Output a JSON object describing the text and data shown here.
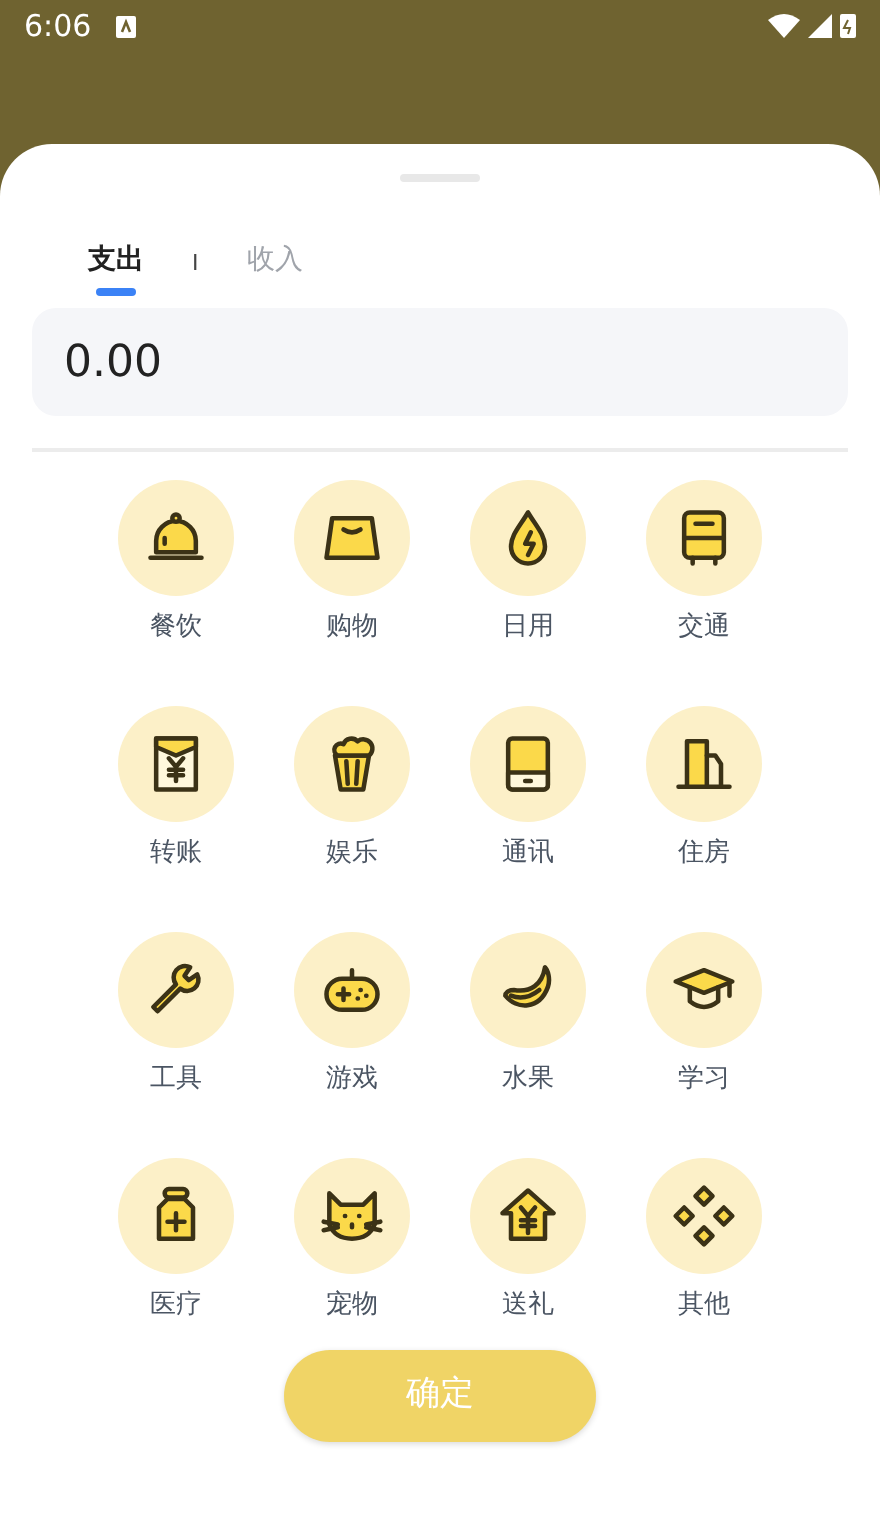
{
  "status_bar": {
    "time": "6:06"
  },
  "tabs": [
    {
      "label": "支出",
      "selected": true
    },
    {
      "label": "收入",
      "selected": false
    }
  ],
  "tab_separator": "I",
  "amount": {
    "value": "0.00"
  },
  "categories": [
    {
      "label": "餐饮"
    },
    {
      "label": "购物"
    },
    {
      "label": "日用"
    },
    {
      "label": "交通"
    },
    {
      "label": "转账"
    },
    {
      "label": "娱乐"
    },
    {
      "label": "通讯"
    },
    {
      "label": "住房"
    },
    {
      "label": "工具"
    },
    {
      "label": "游戏"
    },
    {
      "label": "水果"
    },
    {
      "label": "学习"
    },
    {
      "label": "医疗"
    },
    {
      "label": "宠物"
    },
    {
      "label": "送礼"
    },
    {
      "label": "其他"
    }
  ],
  "confirm_button": "确定"
}
